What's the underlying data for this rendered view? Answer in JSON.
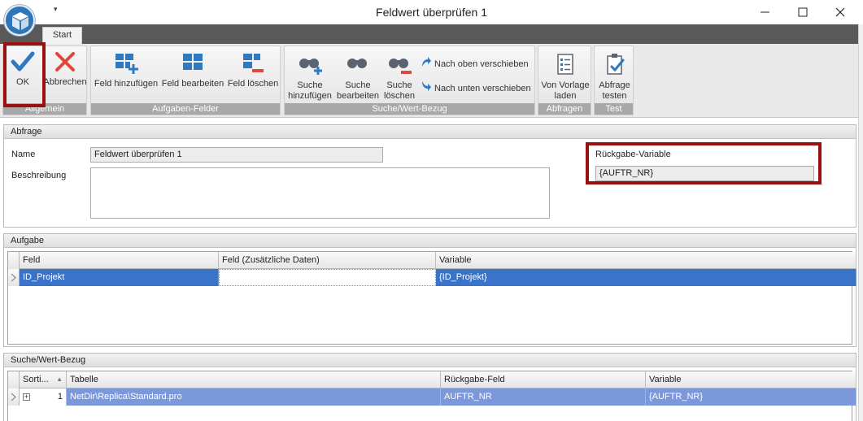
{
  "window": {
    "title": "Feldwert überprüfen 1"
  },
  "tabs": [
    {
      "label": "Start",
      "active": true
    }
  ],
  "ribbon": {
    "groups": [
      {
        "label": "Allgemein",
        "buttons": [
          {
            "label": "OK",
            "icon": "checkmark-icon"
          },
          {
            "label": "Abbrechen",
            "icon": "cancel-x-icon"
          }
        ]
      },
      {
        "label": "Aufgaben-Felder",
        "buttons": [
          {
            "label": "Feld hinzufügen",
            "icon": "add-field-icon"
          },
          {
            "label": "Feld bearbeiten",
            "icon": "edit-field-icon"
          },
          {
            "label": "Feld löschen",
            "icon": "delete-field-icon"
          }
        ]
      },
      {
        "label": "Suche/Wert-Bezug",
        "buttons": [
          {
            "label": "Suche hinzufügen",
            "line1": "Suche",
            "line2": "hinzufügen",
            "icon": "binoculars-add-icon"
          },
          {
            "label": "Suche bearbeiten",
            "line1": "Suche",
            "line2": "bearbeiten",
            "icon": "binoculars-edit-icon"
          },
          {
            "label": "Suche löschen",
            "line1": "Suche",
            "line2": "löschen",
            "icon": "binoculars-delete-icon"
          },
          {
            "label": "Nach oben verschieben",
            "icon": "arrow-up-icon"
          },
          {
            "label": "Nach unten verschieben",
            "icon": "arrow-down-icon"
          }
        ]
      },
      {
        "label": "Abfragen",
        "buttons": [
          {
            "label": "Von Vorlage laden",
            "line1": "Von Vorlage",
            "line2": "laden",
            "icon": "template-list-icon"
          }
        ]
      },
      {
        "label": "Test",
        "buttons": [
          {
            "label": "Abfrage testen",
            "line1": "Abfrage",
            "line2": "testen",
            "icon": "clipboard-check-icon"
          }
        ]
      }
    ]
  },
  "abfrage": {
    "header": "Abfrage",
    "name_label": "Name",
    "name_value": "Feldwert überprüfen 1",
    "beschreibung_label": "Beschreibung",
    "beschreibung_value": "",
    "rueckgabe_label": "Rückgabe-Variable",
    "rueckgabe_value": "{AUFTR_NR}"
  },
  "aufgabe": {
    "header": "Aufgabe",
    "columns": [
      "Feld",
      "Feld (Zusätzliche Daten)",
      "Variable"
    ],
    "rows": [
      {
        "feld": "ID_Projekt",
        "zusatz": "",
        "variable": "{ID_Projekt}"
      }
    ]
  },
  "suche": {
    "header": "Suche/Wert-Bezug",
    "columns": [
      "Sorti...",
      "Tabelle",
      "Rückgabe-Feld",
      "Variable"
    ],
    "rows": [
      {
        "sort": "1",
        "tabelle": "NetDir\\Replica\\Standard.pro",
        "rueckgabe": "AUFTR_NR",
        "variable": "{AUFTR_NR}"
      }
    ]
  },
  "colors": {
    "accent_blue": "#2f76b8",
    "selection": "#3b73c9",
    "highlight_frame": "#9a1111",
    "group_label_bg": "#a8a8a8"
  }
}
